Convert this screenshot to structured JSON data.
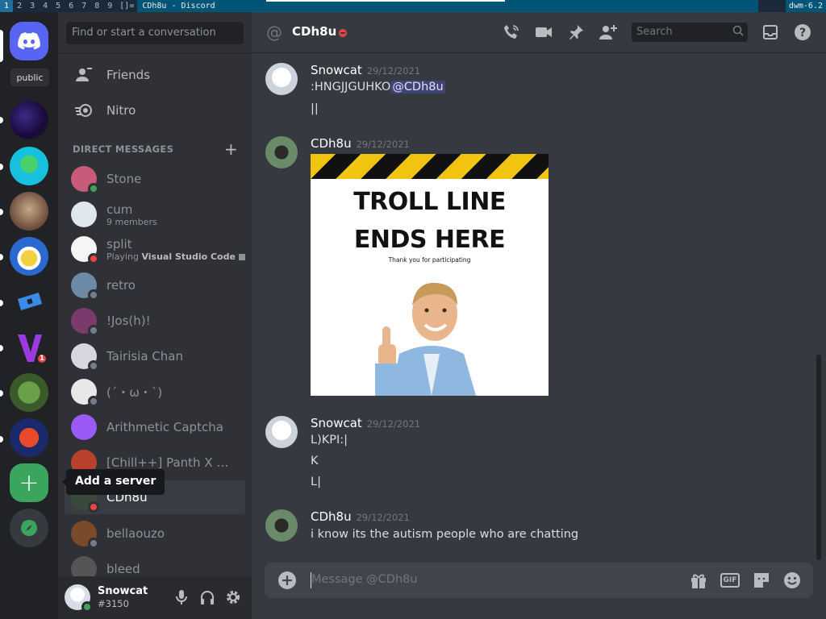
{
  "wm": {
    "tags": [
      "1",
      "2",
      "3",
      "4",
      "5",
      "6",
      "7",
      "8",
      "9"
    ],
    "layout": "[]=",
    "window_title": "CDh8u - Discord",
    "status": "dwm-6.2"
  },
  "servers": {
    "home_tooltip": "public",
    "badge": "1",
    "add_server_tooltip": "Add a server"
  },
  "dm_sidebar": {
    "search_placeholder": "Find or start a conversation",
    "nav": [
      {
        "label": "Friends",
        "icon": "friends-icon"
      },
      {
        "label": "Nitro",
        "icon": "nitro-icon"
      }
    ],
    "section_title": "DIRECT MESSAGES",
    "dms": [
      {
        "name": "Stone",
        "sub": "",
        "status": "online",
        "color": "#c85a7a"
      },
      {
        "name": "cum",
        "sub": "9 members",
        "status": "",
        "color": "#dfe6ee"
      },
      {
        "name": "split",
        "sub_prefix": "Playing ",
        "sub_bold": "Visual Studio Code",
        "status": "dnd",
        "color": "#f5f5f5"
      },
      {
        "name": "retro",
        "sub": "",
        "status": "offline",
        "color": "#6c8aa6"
      },
      {
        "name": "!Jos(h)!",
        "sub": "",
        "status": "offline",
        "color": "#7a3a6c"
      },
      {
        "name": "Tairisia Chan",
        "sub": "",
        "status": "offline",
        "color": "#d9d6e0"
      },
      {
        "name": "(´・ω・`)",
        "sub": "",
        "status": "offline",
        "color": "#e8e8e8"
      },
      {
        "name": "Arithmetic Captcha",
        "sub": "",
        "status": "",
        "color": "#9b59f6"
      },
      {
        "name": "[Chill++] Panth X O...",
        "sub": "",
        "status": "",
        "color": "#b8402c"
      },
      {
        "name": "CDh8u",
        "sub": "",
        "status": "dnd",
        "color": "#3a4a3a"
      },
      {
        "name": "bellaouzo",
        "sub": "",
        "status": "offline",
        "color": "#7a4a2a"
      },
      {
        "name": "bleed",
        "sub": "",
        "status": "",
        "color": "#555555"
      }
    ]
  },
  "user_panel": {
    "name": "Snowcat",
    "tag": "#3150"
  },
  "chat": {
    "channel": "CDh8u",
    "search_placeholder": "Search",
    "messages": [
      {
        "author": "Snowcat",
        "time": "29/12/2021",
        "lines": [
          ":HNGJJGUHKO",
          "||"
        ],
        "mention": "@CDh8u"
      },
      {
        "author": "CDh8u",
        "time": "29/12/2021",
        "image": {
          "line1": "TROLL LINE",
          "line2": "ENDS HERE",
          "small": "Thank you for participating"
        }
      },
      {
        "author": "Snowcat",
        "time": "29/12/2021",
        "lines": [
          "L)KPI:|",
          "K",
          "L|"
        ]
      },
      {
        "author": "CDh8u",
        "time": "29/12/2021",
        "lines": [
          "i know its the autism people who are chatting"
        ]
      }
    ],
    "composer_placeholder": "Message @CDh8u",
    "composer_gif": "GIF"
  }
}
